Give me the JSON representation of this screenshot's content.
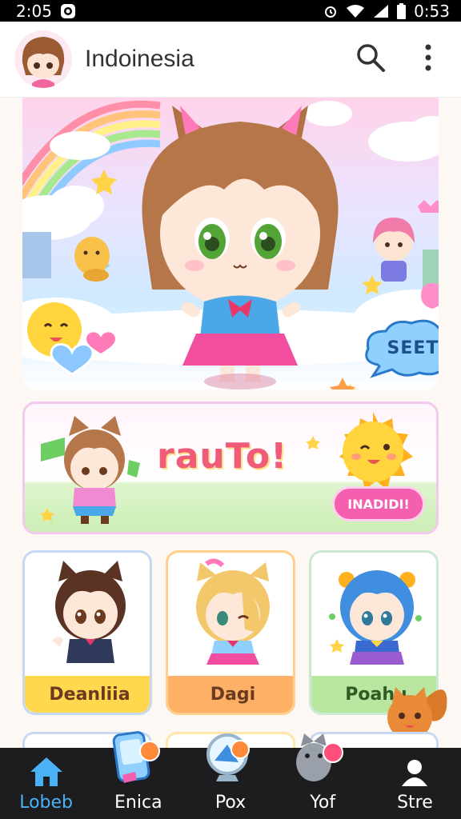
{
  "status_bar": {
    "time": "2:05",
    "clock": "0:53"
  },
  "header": {
    "title": "Indoinesia"
  },
  "hero": {
    "cloud_label": "SEET"
  },
  "banner": {
    "title": "rauTo!",
    "pill_label": "INADIDI!"
  },
  "cards": [
    {
      "label": "Deanliia"
    },
    {
      "label": "Dagi"
    },
    {
      "label": "Poahu"
    }
  ],
  "bottom_nav": [
    {
      "label": "Lobeb",
      "icon": "home-icon",
      "active": true
    },
    {
      "label": "Enica",
      "icon": "phone-game-icon",
      "active": false
    },
    {
      "label": "Pox",
      "icon": "globe-icon",
      "active": false
    },
    {
      "label": "Yof",
      "icon": "cat-icon",
      "active": false
    },
    {
      "label": "Stre",
      "icon": "profile-icon",
      "active": false
    }
  ],
  "colors": {
    "accent": "#4ab1f5",
    "nav_bg": "#1d1d1f",
    "pink": "#f45fb0"
  }
}
